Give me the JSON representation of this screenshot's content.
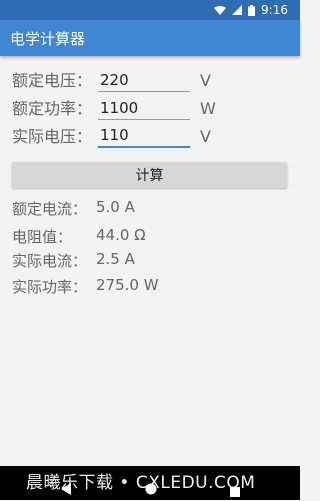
{
  "status": {
    "time": "9:16"
  },
  "app": {
    "title": "电学计算器"
  },
  "form": {
    "rows": [
      {
        "label": "额定电压：",
        "value": "220",
        "unit": "V"
      },
      {
        "label": "额定功率：",
        "value": "1100",
        "unit": "W"
      },
      {
        "label": "实际电压：",
        "value": "110",
        "unit": "V"
      }
    ],
    "button_label": "计算"
  },
  "results": [
    {
      "label": "额定电流：",
      "value": "5.0 A"
    },
    {
      "label": "电阻值：",
      "value": "44.0 Ω"
    },
    {
      "label": "实际电流：",
      "value": "2.5 A"
    },
    {
      "label": "实际功率：",
      "value": "275.0 W"
    }
  ],
  "watermark": {
    "text": "晨曦乐下载 • CXLEDU.COM"
  },
  "colors": {
    "status_bar": "#2e6db4",
    "app_bar": "#3f86d3",
    "accent": "#3f86d3"
  },
  "icons": [
    "wifi-icon",
    "signal-icon",
    "battery-icon",
    "back-icon",
    "home-icon",
    "recent-apps-icon"
  ]
}
